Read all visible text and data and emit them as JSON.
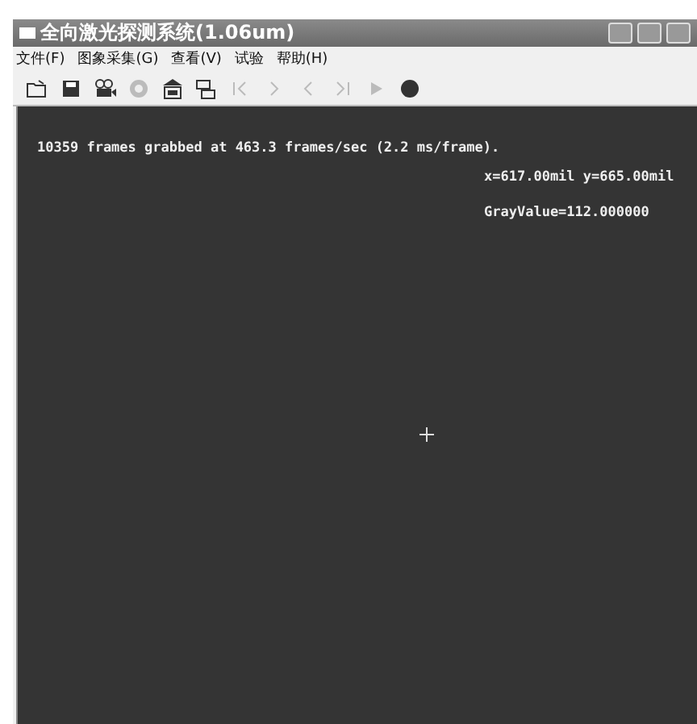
{
  "window": {
    "title": "全向激光探测系统(1.06um)"
  },
  "menu": [
    "文件(F)",
    "图象采集(G)",
    "查看(V)",
    "试验",
    "帮助(H)"
  ],
  "toolbar": [
    {
      "kind": "open",
      "disabled": false
    },
    {
      "kind": "save",
      "disabled": false
    },
    {
      "kind": "camera",
      "disabled": false
    },
    {
      "kind": "stop",
      "disabled": true
    },
    {
      "kind": "snapshot",
      "disabled": false
    },
    {
      "kind": "network",
      "disabled": false
    },
    {
      "kind": "first",
      "disabled": true
    },
    {
      "kind": "next",
      "disabled": true
    },
    {
      "kind": "prev",
      "disabled": true
    },
    {
      "kind": "last",
      "disabled": true
    },
    {
      "kind": "play",
      "disabled": true
    },
    {
      "kind": "ball",
      "disabled": false
    }
  ],
  "canvas": {
    "status": "10359 frames grabbed at 463.3 frames/sec (2.2 ms/frame).",
    "position": "x=617.00mil y=665.00mil",
    "gray_value": "GrayValue=112.000000"
  }
}
